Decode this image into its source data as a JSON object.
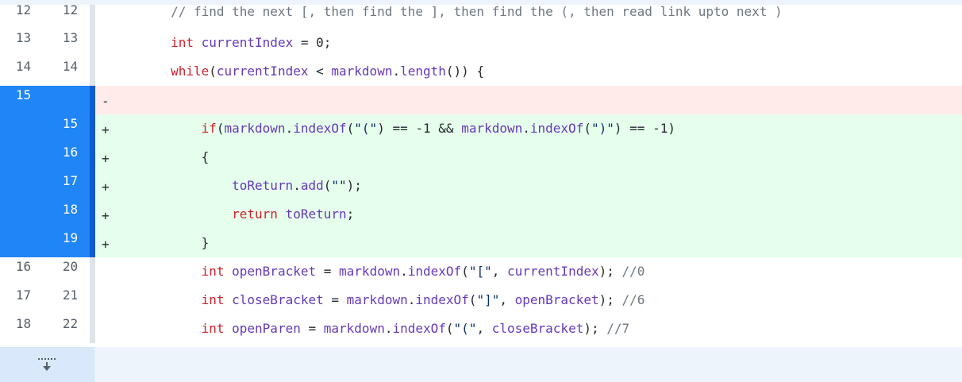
{
  "diff": {
    "rows": [
      {
        "type": "ctx",
        "old": "12",
        "new": "12",
        "sign": "",
        "code": "        // find the next [, then find the ], then find the (, then read link upto next )"
      },
      {
        "type": "ctx",
        "old": "13",
        "new": "13",
        "sign": "",
        "code": "        int currentIndex = 0;"
      },
      {
        "type": "ctx",
        "old": "14",
        "new": "14",
        "sign": "",
        "code": "        while(currentIndex < markdown.length()) {"
      },
      {
        "type": "del",
        "old": "15",
        "new": "",
        "sign": "-",
        "code": ""
      },
      {
        "type": "add",
        "old": "",
        "new": "15",
        "sign": "+",
        "code": "            if(markdown.indexOf(\"(\") == -1 && markdown.indexOf(\")\") == -1)"
      },
      {
        "type": "add",
        "old": "",
        "new": "16",
        "sign": "+",
        "code": "            {"
      },
      {
        "type": "add",
        "old": "",
        "new": "17",
        "sign": "+",
        "code": "                toReturn.add(\"\");"
      },
      {
        "type": "add",
        "old": "",
        "new": "18",
        "sign": "+",
        "code": "                return toReturn;"
      },
      {
        "type": "add",
        "old": "",
        "new": "19",
        "sign": "+",
        "code": "            }"
      },
      {
        "type": "ctx",
        "old": "16",
        "new": "20",
        "sign": "",
        "code": "            int openBracket = markdown.indexOf(\"[\", currentIndex); //0"
      },
      {
        "type": "ctx",
        "old": "17",
        "new": "21",
        "sign": "",
        "code": "            int closeBracket = markdown.indexOf(\"]\", openBracket); //6"
      },
      {
        "type": "ctx",
        "old": "18",
        "new": "22",
        "sign": "",
        "code": "            int openParen = markdown.indexOf(\"(\", closeBracket); //7"
      }
    ]
  },
  "footer": {
    "expand_icon": "expand-down-icon"
  },
  "colors": {
    "selected_gutter": "#2085f7",
    "added_bg": "#e6ffec",
    "deleted_bg": "#ffebe9",
    "keyword": "#cf222e",
    "identifier": "#6639ba",
    "comment": "#6e7781"
  }
}
